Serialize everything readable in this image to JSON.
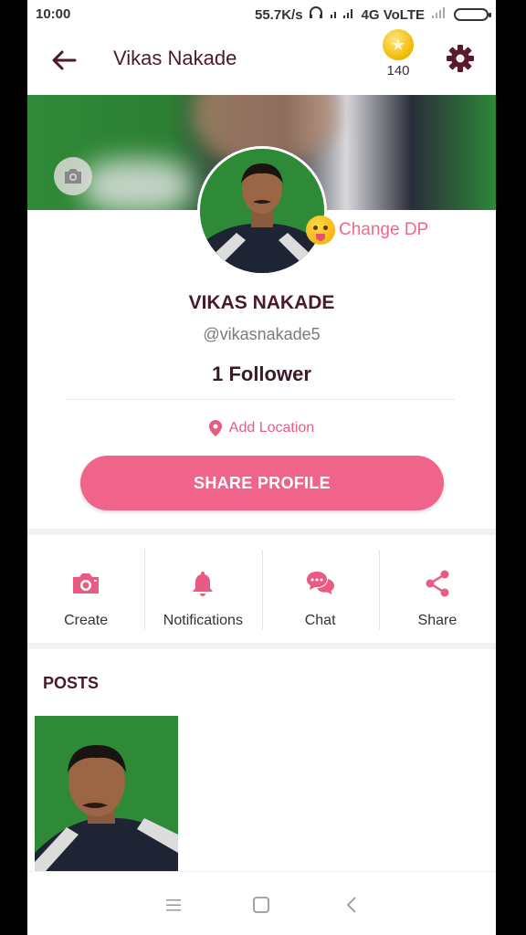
{
  "status_bar": {
    "time": "10:00",
    "net_speed": "55.7K/s",
    "network": "4G VoLTE"
  },
  "app_bar": {
    "title": "Vikas Nakade",
    "coin_count": "140",
    "icons": [
      "arrow-back-icon",
      "coin-icon",
      "gear-icon"
    ]
  },
  "profile": {
    "name": "VIKAS NAKADE",
    "handle": "@vikasnakade5",
    "followers": "1 Follower",
    "change_dp_label": "Change DP",
    "add_location_label": "Add Location",
    "share_profile_label": "SHARE PROFILE"
  },
  "actions": [
    {
      "label": "Create",
      "icon": "camera-icon"
    },
    {
      "label": "Notifications",
      "icon": "bell-icon"
    },
    {
      "label": "Chat",
      "icon": "chat-icon"
    },
    {
      "label": "Share",
      "icon": "share-icon"
    }
  ],
  "posts": {
    "title": "POSTS",
    "count_visible": 1
  },
  "nav_bar": {
    "icons": [
      "menu-icon",
      "home-icon",
      "back-icon"
    ]
  },
  "colors": {
    "accent": "#f0648c",
    "title": "#4a1a2c",
    "icon": "#e85b82",
    "dark_icon": "#5a1a2c"
  }
}
